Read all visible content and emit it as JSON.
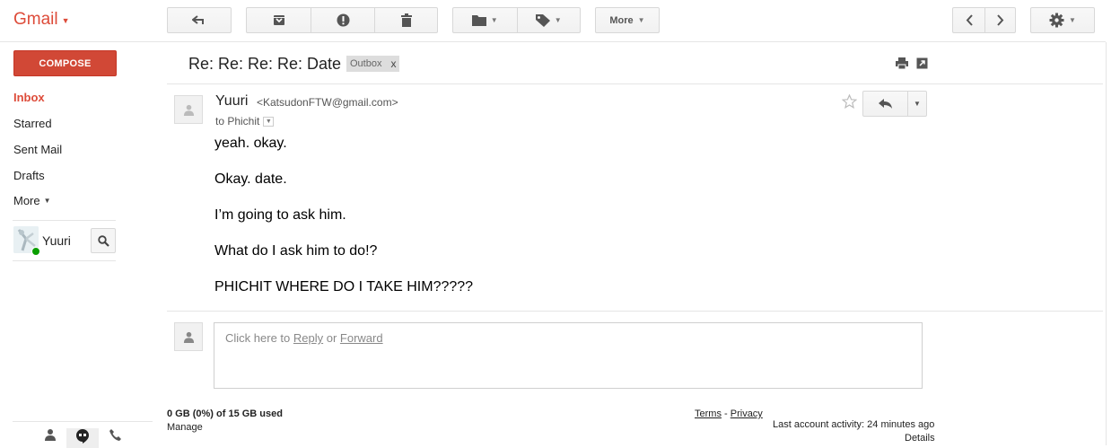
{
  "app": {
    "logo": "Gmail"
  },
  "toolbar": {
    "more_label": "More"
  },
  "nav": {
    "compose": "COMPOSE",
    "items": [
      {
        "label": "Inbox",
        "active": true
      },
      {
        "label": "Starred"
      },
      {
        "label": "Sent Mail"
      },
      {
        "label": "Drafts"
      },
      {
        "label": "More"
      }
    ]
  },
  "chat": {
    "user": "Yuuri",
    "status_color": "#0a9e01"
  },
  "message": {
    "subject": "Re: Re: Re: Re: Date",
    "label": "Outbox",
    "label_remove": "x",
    "sender_name": "Yuuri",
    "sender_email": "<KatsudonFTW@gmail.com>",
    "to": "to Phichit",
    "body": [
      "yeah. okay.",
      "Okay. date.",
      "I’m going to ask him.",
      "What do I ask him to do!?",
      "PHICHIT WHERE DO I TAKE HIM?????"
    ]
  },
  "reply_box": {
    "prefix": "Click here to ",
    "reply": "Reply",
    "or": " or ",
    "forward": "Forward"
  },
  "footer": {
    "storage": "0 GB (0%) of 15 GB used",
    "manage": "Manage",
    "terms": "Terms",
    "dash": "-",
    "privacy": "Privacy",
    "last_activity": "Last account activity: 24 minutes ago",
    "details": "Details"
  },
  "colors": {
    "brand": "#dd4b39",
    "compose": "#d14836"
  }
}
